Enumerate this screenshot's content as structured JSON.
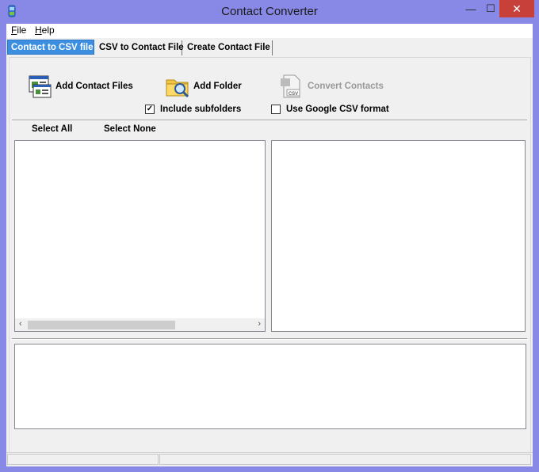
{
  "window": {
    "title": "Contact Converter",
    "close_glyph": "✕",
    "min_glyph": "—",
    "max_glyph": "☐"
  },
  "menu": {
    "items": [
      {
        "label": "File",
        "accel": "F",
        "rest": "ile"
      },
      {
        "label": "Help",
        "accel": "H",
        "rest": "elp"
      }
    ]
  },
  "tabs": [
    {
      "label": "Contact to CSV file",
      "active": true
    },
    {
      "label": "CSV to Contact File",
      "active": false
    },
    {
      "label": "Create Contact File",
      "active": false
    }
  ],
  "toolbar": {
    "add_files": "Add Contact Files",
    "add_folder": "Add Folder",
    "convert": "Convert Contacts",
    "convert_icon_text": "CSV"
  },
  "options": {
    "include_subfolders": {
      "label": "Include subfolders",
      "checked": true,
      "mark": "✓"
    },
    "google_csv": {
      "label": "Use Google CSV format",
      "checked": false
    }
  },
  "selection": {
    "select_all": "Select All",
    "select_none": "Select None"
  },
  "scroll": {
    "left": "‹",
    "right": "›"
  }
}
